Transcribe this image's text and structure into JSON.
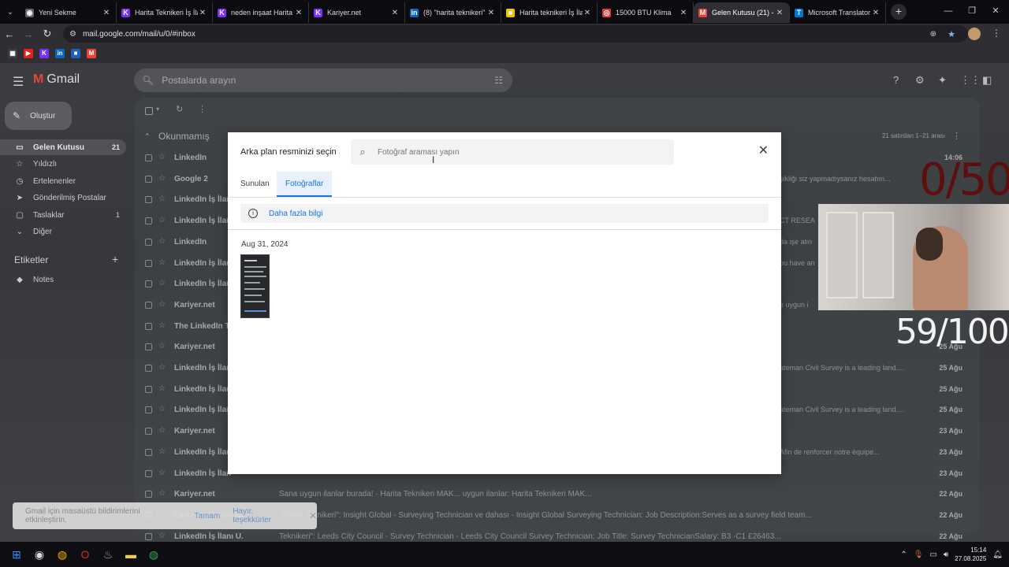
{
  "browser": {
    "tabs": [
      {
        "label": "Yeni Sekme",
        "favicon": "chrome-icon",
        "color": "#5f6368"
      },
      {
        "label": "Harita Teknikeri İş İla",
        "favicon": "K",
        "color": "#7b2ff7"
      },
      {
        "label": "neden inşaat Harita",
        "favicon": "K",
        "color": "#7b2ff7"
      },
      {
        "label": "Kariyer.net",
        "favicon": "K",
        "color": "#7b2ff7"
      },
      {
        "label": "(8) \"harita teknikeri\"",
        "favicon": "in",
        "color": "#0a66c2"
      },
      {
        "label": "Harita teknikeri İş İlan",
        "favicon": "■",
        "color": "#f2c200"
      },
      {
        "label": "15000 BTU Klima",
        "favicon": "◎",
        "color": "#e53935"
      },
      {
        "label": "Gelen Kutusu (21) - ",
        "favicon": "M",
        "color": "#ea4335",
        "active": true
      },
      {
        "label": "Microsoft Translator",
        "favicon": "T",
        "color": "#0078d4"
      }
    ],
    "url": "mail.google.com/mail/u/0/#inbox",
    "bookmarks": [
      {
        "name": "apps-icon",
        "glyph": "▦",
        "color": "#3c3c42"
      },
      {
        "name": "youtube-icon",
        "glyph": "▶",
        "color": "#e62117"
      },
      {
        "name": "kariyer-icon",
        "glyph": "K",
        "color": "#7b2ff7"
      },
      {
        "name": "linkedin-icon",
        "glyph": "in",
        "color": "#0a66c2"
      },
      {
        "name": "ua-icon",
        "glyph": "■",
        "color": "#1f5fbf"
      },
      {
        "name": "gmail-icon",
        "glyph": "M",
        "color": "#ea4335"
      }
    ]
  },
  "gmail": {
    "brand": "Gmail",
    "search_placeholder": "Postalarda arayın",
    "compose": "Oluştur",
    "nav": [
      {
        "label": "Gelen Kutusu",
        "count": "21",
        "icon": "▭",
        "active": true
      },
      {
        "label": "Yıldızlı",
        "count": "",
        "icon": "☆"
      },
      {
        "label": "Ertelenenler",
        "count": "",
        "icon": "◷"
      },
      {
        "label": "Gönderilmiş Postalar",
        "count": "",
        "icon": "➤"
      },
      {
        "label": "Taslaklar",
        "count": "1",
        "icon": "▢"
      },
      {
        "label": "Diğer",
        "count": "",
        "icon": "⌄"
      }
    ],
    "labels_heading": "Etiketler",
    "labels": [
      {
        "label": "Notes",
        "icon": "◆"
      }
    ],
    "section": "Okunmamış",
    "section_count": "21 satırdan 1–21 arası",
    "rows": [
      {
        "sender": "LinkedIn",
        "snippet": "",
        "tail": "",
        "date": "14:06"
      },
      {
        "sender": "Google 2",
        "snippet": "",
        "tail": "şikliği siz yapmadıysanız hesabın...",
        "date": ""
      },
      {
        "sender": "LinkedIn İş İlan",
        "snippet": "",
        "tail": "",
        "date": ""
      },
      {
        "sender": "LinkedIn İş İlan",
        "snippet": "",
        "tail": "CT RESEA",
        "date": ""
      },
      {
        "sender": "LinkedIn",
        "snippet": "",
        "tail": "da işe alın",
        "date": ""
      },
      {
        "sender": "LinkedIn İş İlan",
        "snippet": "",
        "tail": "ou have an",
        "date": ""
      },
      {
        "sender": "LinkedIn İş İlan",
        "snippet": "",
        "tail": "",
        "date": ""
      },
      {
        "sender": "Kariyer.net",
        "snippet": "",
        "tail": "e uygun i",
        "date": ""
      },
      {
        "sender": "The LinkedIn Te",
        "snippet": "",
        "tail": "",
        "date": ""
      },
      {
        "sender": "Kariyer.net",
        "snippet": "",
        "tail": "",
        "date": "25 Ağu"
      },
      {
        "sender": "LinkedIn İş İlan",
        "snippet": "",
        "tail": "ateman Civil Survey is a leading land....",
        "date": "25 Ağu"
      },
      {
        "sender": "LinkedIn İş İlan",
        "snippet": "",
        "tail": "",
        "date": "25 Ağu"
      },
      {
        "sender": "LinkedIn İş İlan",
        "snippet": "",
        "tail": "ateman Civil Survey is a leading land....",
        "date": "25 Ağu"
      },
      {
        "sender": "Kariyer.net",
        "snippet": "",
        "tail": "",
        "date": "23 Ağu"
      },
      {
        "sender": "LinkedIn İş İlan",
        "snippet": "",
        "tail": "Afin de renforcer notre équipe...",
        "date": "23 Ağu"
      },
      {
        "sender": "LinkedIn İş İlan",
        "snippet": "",
        "tail": "",
        "date": "23 Ağu"
      },
      {
        "sender": "Kariyer.net",
        "snippet": "Sana uygun ilanlar burada! · Harita Teknikeri MAK... uygun ilanlar: Harita Teknikeri MAK...",
        "tail": "",
        "date": "22 Ağu"
      },
      {
        "sender": "LinkedIn İş İlanı U.",
        "snippet": "\"Harita Teknikeri\": Insight Global - Surveying Technician ve dahası - Insight Global Surveying Technician: Job Description:Serves as a survey field team...",
        "tail": "",
        "date": "22 Ağu"
      },
      {
        "sender": "LinkedIn İş İlanı U.",
        "snippet": "Teknikeri\": Leeds City Council - Survey Technician - Leeds City Council Survey Technician: Job Title: Survey TechnicianSalary: B3 -C1 £26463...",
        "tail": "",
        "date": "22 Ağu"
      }
    ]
  },
  "modal": {
    "title": "Arka plan resminizi seçin",
    "search_placeholder": "Fotoğraf araması yapın",
    "tabs": [
      "Sunulan",
      "Fotoğraflar"
    ],
    "active_tab": "Fotoğraflar",
    "info_link": "Daha fazla bilgi",
    "date_heading": "Aug 31, 2024"
  },
  "overlay": {
    "counter_top": "0/50",
    "counter_bottom": "59/100"
  },
  "toast": {
    "message": "Gmail için masaüstü bildirimlerini etkinleştirin.",
    "ok": "Tamam",
    "no": "Hayır, teşekkürler"
  },
  "taskbar": {
    "apps": [
      {
        "name": "windows-start-icon",
        "glyph": "⊞",
        "color": "#2f8fff"
      },
      {
        "name": "obs-icon",
        "glyph": "◉",
        "color": "#dddddd"
      },
      {
        "name": "chrome-icon",
        "glyph": "◍",
        "color": "#f4b400"
      },
      {
        "name": "opera-icon",
        "glyph": "O",
        "color": "#e0242c"
      },
      {
        "name": "steam-icon",
        "glyph": "♨",
        "color": "#9ab"
      },
      {
        "name": "file-explorer-icon",
        "glyph": "▬",
        "color": "#f2c94c"
      },
      {
        "name": "chrome-active-icon",
        "glyph": "◍",
        "color": "#34a853"
      }
    ],
    "time": "15:14",
    "date": "27.08.2025"
  }
}
